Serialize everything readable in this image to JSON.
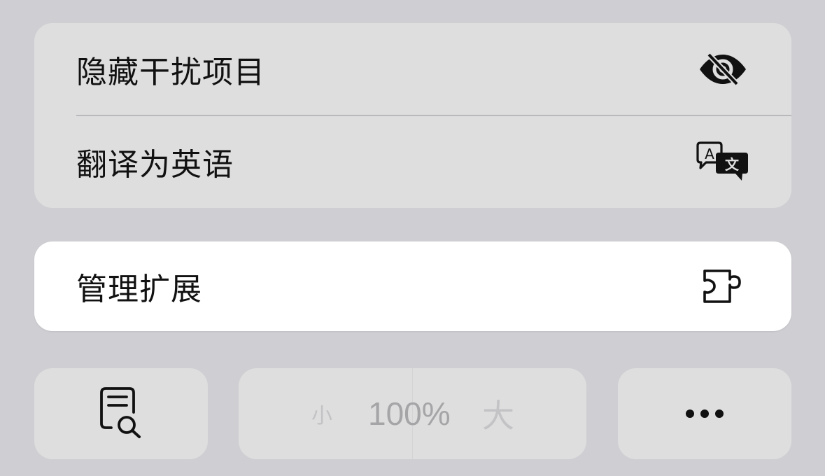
{
  "menu": {
    "items": [
      {
        "label": "隐藏干扰项目",
        "icon": "eye-slash-icon"
      },
      {
        "label": "翻译为英语",
        "icon": "translate-icon"
      }
    ]
  },
  "extensions": {
    "label": "管理扩展",
    "icon": "puzzle-piece-icon"
  },
  "toolbar": {
    "reader_icon": "document-search-icon",
    "zoom": {
      "smaller_label": "小",
      "value": "100%",
      "larger_label": "大"
    },
    "more_icon": "ellipsis-icon"
  }
}
